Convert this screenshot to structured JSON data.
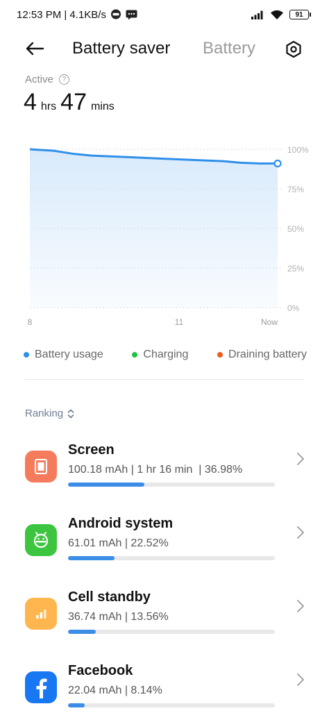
{
  "status_bar": {
    "time_speed": "12:53 PM | 4.1KB/s",
    "battery_level": "91"
  },
  "header": {
    "title": "Battery saver",
    "tab_battery": "Battery"
  },
  "active": {
    "label": "Active",
    "hours": "4",
    "hours_unit": "hrs",
    "minutes": "47",
    "minutes_unit": "mins"
  },
  "chart_data": {
    "type": "area",
    "x_ticks": [
      "8",
      "11",
      "Now"
    ],
    "y_ticks": [
      "100%",
      "75%",
      "50%",
      "25%",
      "0%"
    ],
    "ylim": [
      0,
      100
    ],
    "grid": true,
    "series": [
      {
        "name": "Battery usage",
        "x": [
          0,
          0.1,
          0.18,
          0.25,
          0.4,
          0.55,
          0.7,
          0.78,
          0.85,
          0.93,
          1.0
        ],
        "values": [
          100,
          99,
          97,
          96,
          95,
          94,
          93,
          92.5,
          91.5,
          91,
          91
        ]
      }
    ],
    "legend": [
      {
        "label": "Battery usage",
        "color": "#2f8fe8"
      },
      {
        "label": "Charging",
        "color": "#22c24a"
      },
      {
        "label": "Draining battery",
        "color": "#f05a20"
      }
    ],
    "colors": {
      "line": "#2f8fe8",
      "fill": "#d6e9fb"
    }
  },
  "ranking": {
    "label": "Ranking"
  },
  "apps": [
    {
      "name": "Screen",
      "stats": "100.18 mAh | 1 hr 16 min  | 36.98%",
      "percent": 36.98,
      "icon": "screen-icon",
      "color": "#f47c5d"
    },
    {
      "name": "Android system",
      "stats": "61.01 mAh | 22.52%",
      "percent": 22.52,
      "icon": "android-icon",
      "color": "#3dc53f"
    },
    {
      "name": "Cell standby",
      "stats": "36.74 mAh | 13.56%",
      "percent": 13.56,
      "icon": "signal-icon",
      "color": "#ffb64f"
    },
    {
      "name": "Facebook",
      "stats": "22.04 mAh | 8.14%",
      "percent": 8.14,
      "icon": "facebook-icon",
      "color": "#1778f2"
    }
  ]
}
